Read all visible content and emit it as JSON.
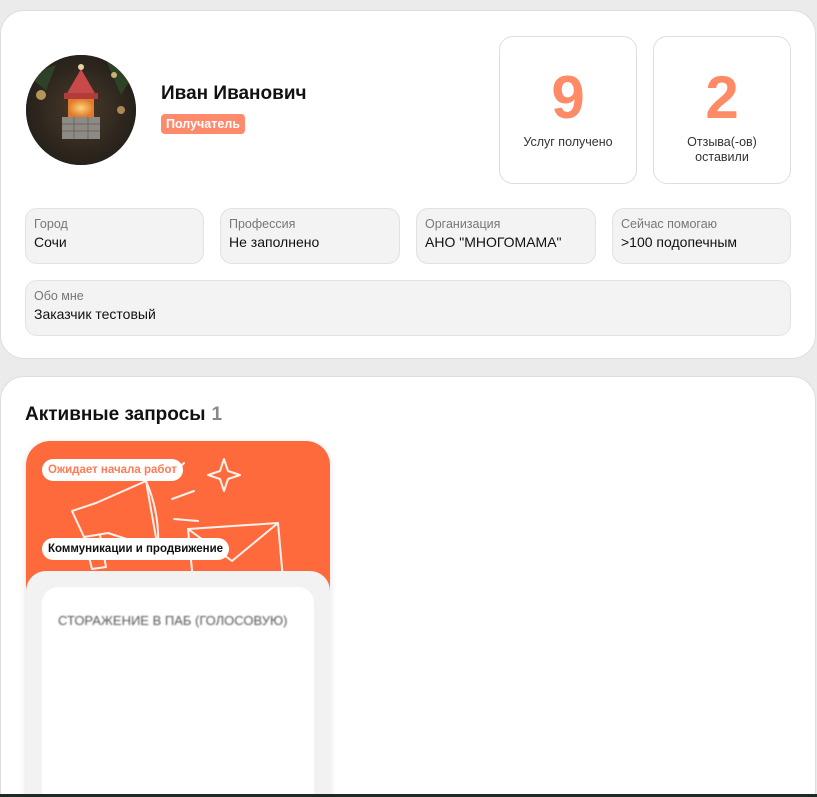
{
  "profile": {
    "name": "Иван Иванович",
    "role": "Получатель",
    "stats": [
      {
        "value": "9",
        "label": "Услуг получено"
      },
      {
        "value": "2",
        "label": "Отзыва(-ов) оставили"
      }
    ],
    "fields": [
      {
        "label": "Город",
        "value": "Сочи"
      },
      {
        "label": "Профессия",
        "value": "Не заполнено"
      },
      {
        "label": "Организация",
        "value": "АНО \"МНОГОМАМА\""
      },
      {
        "label": "Сейчас помогаю",
        "value": ">100 подопечным"
      }
    ],
    "about": {
      "label": "Обо мне",
      "value": "Заказчик тестовый"
    }
  },
  "requests": {
    "title": "Активные запросы",
    "count": "1",
    "items": [
      {
        "status": "Ожидает начала работ",
        "category": "Коммуникации и продвижение",
        "text": "СТОРАЖЕНИЕ В ПАБ (ГОЛОСОВУЮ)"
      }
    ]
  },
  "colors": {
    "accent": "#ff8a66",
    "card_header": "#ff6a3d",
    "badge": "#ff8a6b"
  },
  "icons": [
    "avatar-image",
    "megaphone-illustration",
    "envelope-illustration",
    "sparkle-illustration"
  ]
}
